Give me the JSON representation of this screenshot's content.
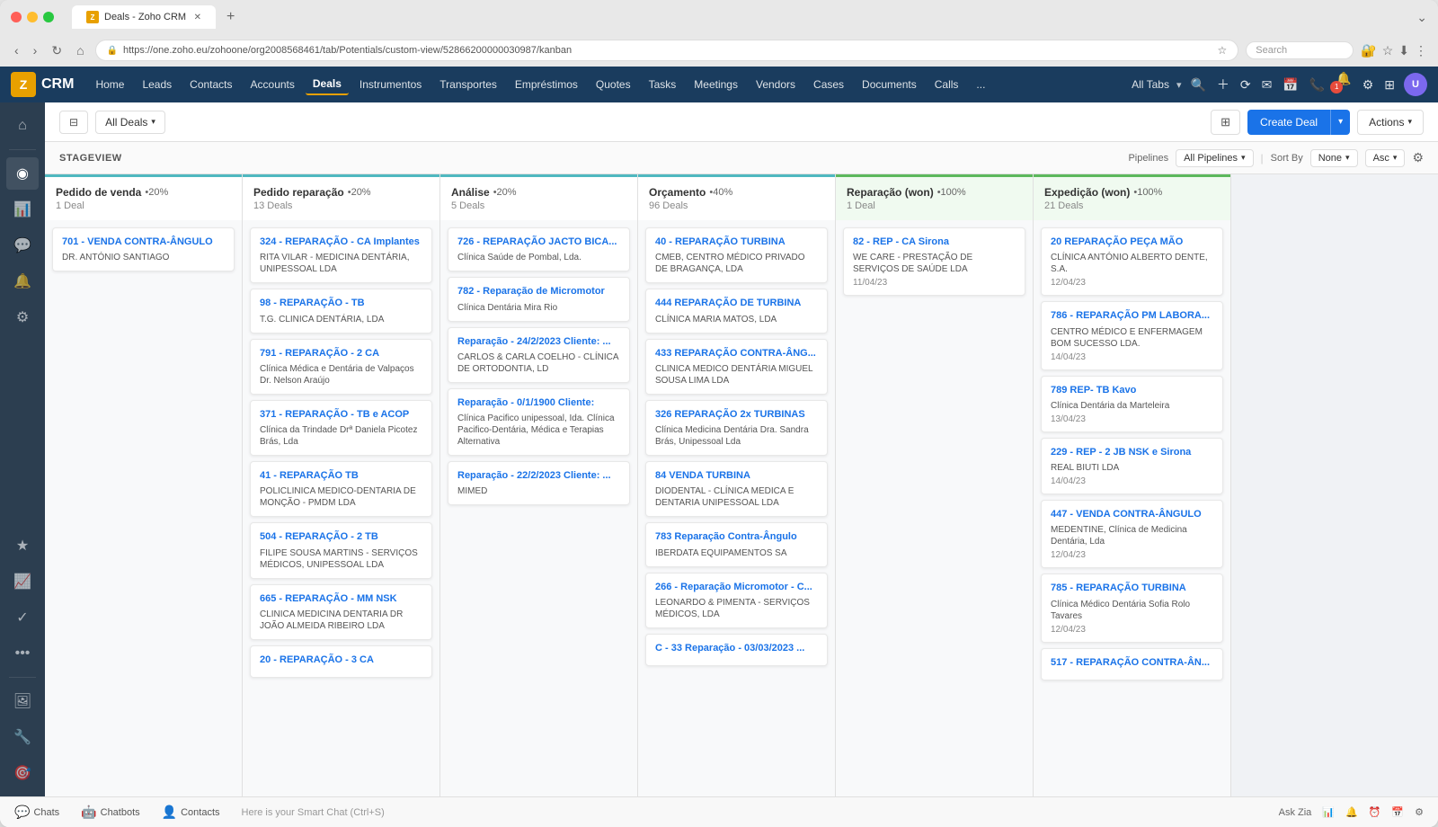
{
  "browser": {
    "tab_label": "Deals - Zoho CRM",
    "tab_icon": "Z",
    "url": "https://one.zoho.eu/zohoone/org2008568461/tab/Potentials/custom-view/52866200000030987/kanban",
    "search_placeholder": "Search",
    "new_tab": "+"
  },
  "nav": {
    "logo": "CRM",
    "items": [
      "Home",
      "Leads",
      "Contacts",
      "Accounts",
      "Deals",
      "Instrumentos",
      "Transportes",
      "Empréstimos",
      "Quotes",
      "Tasks",
      "Meetings",
      "Vendors",
      "Cases",
      "Documents",
      "Calls",
      "..."
    ],
    "all_tabs": "All Tabs",
    "active_item": "Deals"
  },
  "toolbar": {
    "filter_label": "All Deals",
    "sort_icon": "⊞",
    "create_deal": "Create Deal",
    "actions": "Actions"
  },
  "stageview": {
    "label": "STAGEVIEW",
    "pipelines_label": "Pipelines",
    "pipelines_value": "All Pipelines",
    "sort_by_label": "Sort By",
    "sort_by_value": "None",
    "asc_value": "Asc"
  },
  "columns": [
    {
      "title": "Pedido de venda",
      "percent": "•20%",
      "count": "1 Deal",
      "type": "normal",
      "cards": [
        {
          "title": "701 - VENDA CONTRA-ÂNGULO",
          "account": "DR. ANTÓNIO SANTIAGO",
          "date": ""
        }
      ]
    },
    {
      "title": "Pedido reparação",
      "percent": "•20%",
      "count": "13 Deals",
      "type": "normal",
      "cards": [
        {
          "title": "324 - REPARAÇÃO - CA Implantes",
          "account": "RITA VILAR - MEDICINA DENTÁRIA, UNIPESSOAL LDA",
          "date": ""
        },
        {
          "title": "98 - REPARAÇÃO - TB",
          "account": "T.G. CLINICA DENTÁRIA, LDA",
          "date": ""
        },
        {
          "title": "791 - REPARAÇÃO - 2 CA",
          "account": "Clínica Médica e Dentária de Valpaços Dr. Nelson Araújo",
          "date": ""
        },
        {
          "title": "371 - REPARAÇÃO - TB e ACOP",
          "account": "Clínica da Trindade Drª Daniela Picotez Brás, Lda",
          "date": ""
        },
        {
          "title": "41 - REPARAÇÃO TB",
          "account": "POLICLINICA MEDICO-DENTARIA DE MONÇÃO - PMDM LDA",
          "date": ""
        },
        {
          "title": "504 - REPARAÇÃO - 2 TB",
          "account": "FILIPE SOUSA MARTINS - SERVIÇOS MÉDICOS, UNIPESSOAL LDA",
          "date": ""
        },
        {
          "title": "665 - REPARAÇÃO - MM NSK",
          "account": "CLINICA MEDICINA DENTARIA DR JOÃO ALMEIDA RIBEIRO LDA",
          "date": ""
        },
        {
          "title": "20 - REPARAÇÃO - 3 CA",
          "account": "",
          "date": ""
        }
      ]
    },
    {
      "title": "Análise",
      "percent": "•20%",
      "count": "5 Deals",
      "type": "normal",
      "cards": [
        {
          "title": "726 - REPARAÇÃO JACTO BICA...",
          "account": "Clínica Saúde de Pombal, Lda.",
          "date": ""
        },
        {
          "title": "782 - Reparação de Micromotor",
          "account": "Clínica Dentária Mira Rio",
          "date": ""
        },
        {
          "title": "Reparação - 24/2/2023 Cliente: ...",
          "account": "CARLOS & CARLA COELHO - CLÍNICA DE ORTODONTIA, LD",
          "date": ""
        },
        {
          "title": "Reparação - 0/1/1900 Cliente:",
          "account": "Clínica Pacifico unipessoal, Ida. Clínica Pacifico-Dentária, Médica e Terapias Alternativa",
          "date": ""
        },
        {
          "title": "Reparação - 22/2/2023 Cliente: ...",
          "account": "MIMED",
          "date": ""
        }
      ]
    },
    {
      "title": "Orçamento",
      "percent": "•40%",
      "count": "96 Deals",
      "type": "normal",
      "cards": [
        {
          "title": "40 - REPARAÇÃO TURBINA",
          "account": "CMEB, CENTRO MÉDICO PRIVADO DE BRAGANÇA, LDA",
          "date": ""
        },
        {
          "title": "444 REPARAÇÃO DE TURBINA",
          "account": "CLÍNICA MARIA MATOS, LDA",
          "date": ""
        },
        {
          "title": "433 REPARAÇÃO CONTRA-ÂNG...",
          "account": "CLINICA MEDICO DENTÁRIA MIGUEL SOUSA LIMA LDA",
          "date": ""
        },
        {
          "title": "326 REPARAÇÃO 2x TURBINAS",
          "account": "Clínica Medicina Dentária Dra. Sandra Brás, Unipessoal Lda",
          "date": ""
        },
        {
          "title": "84 VENDA TURBINA",
          "account": "DIODENTAL - CLÍNICA MEDICA E DENTARIA UNIPESSOAL LDA",
          "date": ""
        },
        {
          "title": "783 Reparação Contra-Ângulo",
          "account": "IBERDATA EQUIPAMENTOS SA",
          "date": ""
        },
        {
          "title": "266 - Reparação Micromotor - C...",
          "account": "LEONARDO & PIMENTA - SERVIÇOS MÉDICOS, LDA",
          "date": ""
        },
        {
          "title": "C - 33 Reparação - 03/03/2023 ...",
          "account": "",
          "date": ""
        }
      ]
    },
    {
      "title": "Reparação (won)",
      "percent": "•100%",
      "count": "1 Deal",
      "type": "won",
      "cards": [
        {
          "title": "82 - REP - CA Sirona",
          "account": "WE CARE - PRESTAÇÃO DE SERVIÇOS DE SAÚDE LDA",
          "date": "11/04/23"
        }
      ]
    },
    {
      "title": "Expedição (won)",
      "percent": "•100%",
      "count": "21 Deals",
      "type": "won",
      "cards": [
        {
          "title": "20 REPARAÇÃO PEÇA MÃO",
          "account": "CLÍNICA ANTÓNIO ALBERTO DENTE, S.A.",
          "date": "12/04/23"
        },
        {
          "title": "786 - REPARAÇÃO PM LABORA...",
          "account": "CENTRO MÉDICO E ENFERMAGEM BOM SUCESSO LDA.",
          "date": "14/04/23"
        },
        {
          "title": "789 REP- TB Kavo",
          "account": "Clínica Dentária da Marteleira",
          "date": "13/04/23"
        },
        {
          "title": "229 - REP - 2 JB NSK e Sirona",
          "account": "REAL BIUTI LDA",
          "date": "14/04/23"
        },
        {
          "title": "447 - VENDA CONTRA-ÂNGULO",
          "account": "MEDENTINE, Clínica de Medicina Dentária, Lda",
          "date": "12/04/23"
        },
        {
          "title": "785 - REPARAÇÃO TURBINA",
          "account": "Clínica Médico Dentária Sofia Rolo Tavares",
          "date": "12/04/23"
        },
        {
          "title": "517 - REPARAÇÃO CONTRA-ÂN...",
          "account": "",
          "date": ""
        }
      ]
    }
  ],
  "bottom": {
    "chats_label": "Chats",
    "chatbots_label": "Chatbots",
    "contacts_label": "Contacts",
    "smart_chat": "Here is your Smart Chat (Ctrl+S)",
    "ask_zia": "Ask Zia"
  },
  "sidebar_icons": [
    "☰",
    "👁",
    "📊",
    "💬",
    "🔔",
    "⚙",
    "★",
    "📈",
    "✓",
    "•••",
    "🖼",
    "🔧",
    "🎯"
  ]
}
